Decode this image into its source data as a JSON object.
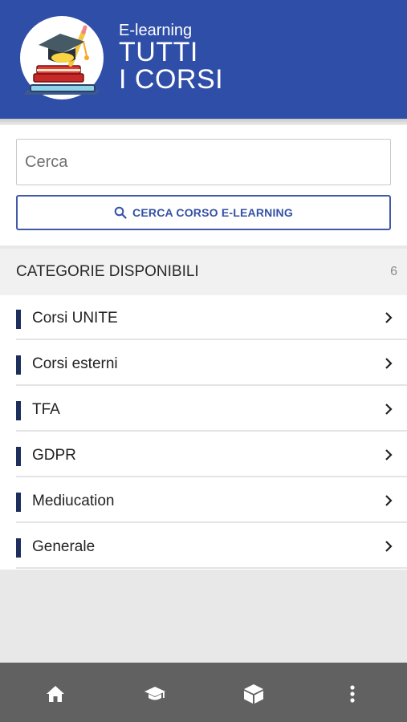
{
  "header": {
    "subtitle": "E-learning",
    "title_line1": "TUTTI",
    "title_line2": "I CORSI"
  },
  "search": {
    "placeholder": "Cerca",
    "value": "",
    "button_label": "CERCA CORSO E-LEARNING",
    "button_icon": "search-icon"
  },
  "categories": {
    "title": "CATEGORIE DISPONIBILI",
    "count": "6",
    "items": [
      {
        "label": "Corsi UNITE"
      },
      {
        "label": "Corsi esterni"
      },
      {
        "label": "TFA"
      },
      {
        "label": "GDPR"
      },
      {
        "label": "Mediucation"
      },
      {
        "label": "Generale"
      }
    ]
  },
  "bottom_nav": {
    "icons": [
      "home-icon",
      "graduation-cap-icon",
      "cube-icon",
      "more-vert-icon"
    ]
  },
  "colors": {
    "header_bg": "#2f4ea8",
    "accent": "#3351a6",
    "category_bar": "#1d2d5c",
    "bottom_nav_bg": "#616161"
  }
}
